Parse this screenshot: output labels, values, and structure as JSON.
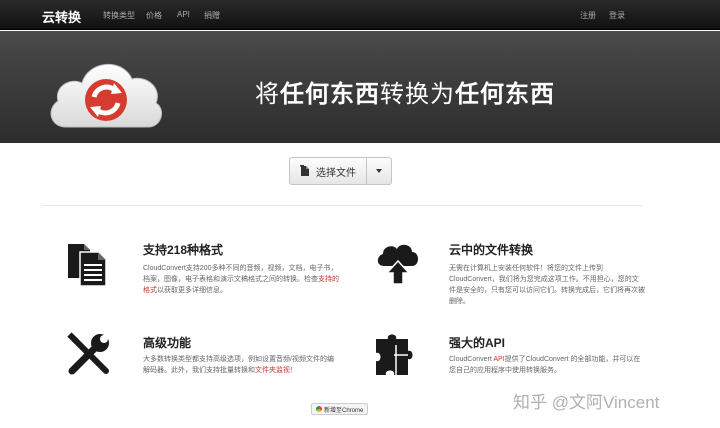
{
  "nav": {
    "brand": "云转换",
    "links": [
      "转换类型",
      "价格",
      "API",
      "捐赠"
    ],
    "register": "注册",
    "login": "登录"
  },
  "hero": {
    "title_part1": "将",
    "title_part2": "任何东西",
    "title_part3": "转换为",
    "title_part4": "任何东西",
    "logo_icon": "cloud-refresh-icon"
  },
  "upload": {
    "select_label": "选择文件"
  },
  "features": [
    {
      "icon": "documents-icon",
      "title": "支持218种格式",
      "desc_before": "CloudConvert支持200多种不同的音频，视频，文档，电子书，档案，图像，电子表格和演示文稿格式之间的转换。检查",
      "desc_link": "支持的格式",
      "desc_after": "以获取更多详细信息。"
    },
    {
      "icon": "cloud-upload-icon",
      "title": "云中的文件转换",
      "desc_before": "无需在计算机上安装任何软件！将您的文件上传到CloudConvert，我们将为您完成这项工作。不用担心，您的文件是安全的，只有您可以访问它们。转换完成后，它们将再次被删除。",
      "desc_link": "",
      "desc_after": ""
    },
    {
      "icon": "tools-icon",
      "title": "高级功能",
      "desc_before": "大多数转换类型都支持高级选项，例如设置音频/视频文件的编解码器。此外，我们支持批量转换和",
      "desc_link": "文件夹监视",
      "desc_after": "！"
    },
    {
      "icon": "puzzle-icon",
      "title": "强大的API",
      "desc_before": "CloudConvert ",
      "desc_link": "API",
      "desc_after": "提供了CloudConvert 的全部功能，并可以在您自己的应用程序中使用转换服务。"
    }
  ],
  "chrome_badge": "新增至Chrome",
  "watermark": "知乎 @文阿Vincent"
}
